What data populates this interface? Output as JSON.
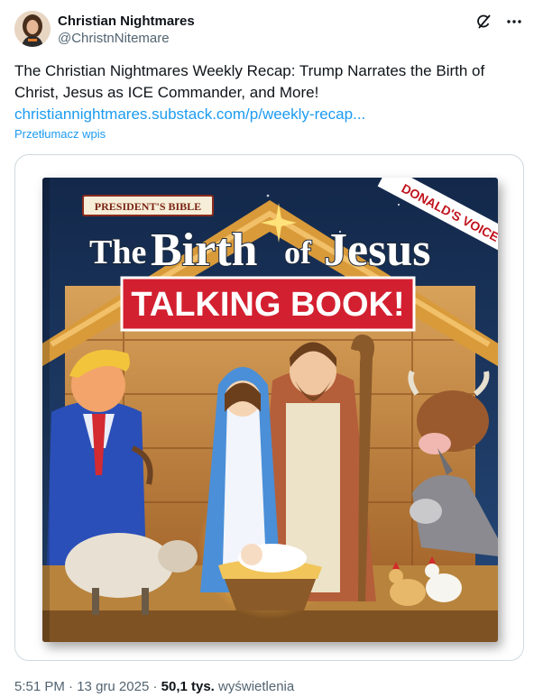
{
  "author": {
    "name": "Christian Nightmares",
    "handle": "@ChristnNitemare"
  },
  "tweet": {
    "text": "The Christian Nightmares Weekly Recap: Trump Narrates the Birth of Christ, Jesus as ICE Commander, and More!",
    "link": "christiannightmares.substack.com/p/weekly-recap...",
    "translate_label": "Przetłumacz wpis"
  },
  "book_cover": {
    "series_banner": "PRESIDENT'S BIBLE",
    "title_the": "The",
    "title_birth": "Birth",
    "title_of": "of",
    "title_jesus": "Jesus",
    "subtitle": "TALKING BOOK!",
    "corner_ribbon": "DONALD'S VOICE",
    "colors": {
      "banner_red": "#d32030",
      "sky": "#1c3a64",
      "barn": "#c07a30"
    }
  },
  "meta": {
    "time": "5:51 PM",
    "separator": "·",
    "date": "13 gru 2025",
    "views_count": "50,1 tys.",
    "views_label": "wyświetlenia"
  },
  "icons": [
    "grok-icon",
    "more-icon"
  ]
}
